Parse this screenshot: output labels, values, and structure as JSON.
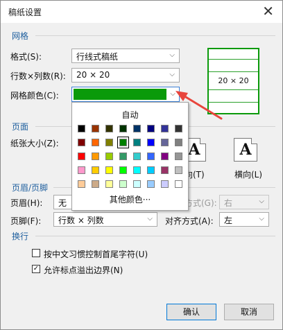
{
  "window": {
    "title": "稿纸设置",
    "close_glyph": "✕"
  },
  "grid_section": {
    "title": "网格",
    "style_label": "格式(S):",
    "style_value": "行线式稿纸",
    "rows_cols_label": "行数×列数(R):",
    "rows_cols_value": "20 × 20",
    "color_label": "网格颜色(C):",
    "color_value_hex": "#0a9a0a"
  },
  "preview": {
    "text": "20 × 20",
    "line_color": "#2aa02a"
  },
  "color_dropdown": {
    "auto_label": "自动",
    "more_label": "其他颜色···",
    "rows": [
      [
        "#000000",
        "#993300",
        "#333300",
        "#003300",
        "#003366",
        "#000080",
        "#333399",
        "#333333"
      ],
      [
        "#800000",
        "#ff6600",
        "#808000",
        "#008000",
        "#008080",
        "#0000ff",
        "#666699",
        "#808080"
      ],
      [
        "#ff0000",
        "#ff9900",
        "#99cc00",
        "#339966",
        "#33cccc",
        "#3366ff",
        "#800080",
        "#969696"
      ],
      [
        "#ff99cc",
        "#ffcc00",
        "#ffff00",
        "#00ff00",
        "#00ffff",
        "#00ccff",
        "#993366",
        "#c0c0c0"
      ],
      [
        "#ffcc99",
        "#ccaa88",
        "#ffff99",
        "#ccffcc",
        "#ccffff",
        "#99ccff",
        "#ccccff",
        "#ffffff"
      ]
    ],
    "selected": {
      "row": 1,
      "col": 3
    }
  },
  "page_section": {
    "title": "页面",
    "size_label": "纸张大小(Z):",
    "orient_glyph": "A",
    "portrait_label": "向(T)",
    "landscape_label": "横向(L)"
  },
  "header_footer_section": {
    "title": "页眉/页脚",
    "header_label": "页眉(H):",
    "header_value": "无",
    "header_align_label": "方式(G):",
    "header_align_value": "右",
    "footer_label": "页脚(F):",
    "footer_value": "行数 × 列数",
    "footer_align_label": "对齐方式(A):",
    "footer_align_value": "左"
  },
  "wrap_section": {
    "title": "换行",
    "option1_label": "按中文习惯控制首尾字符(U)",
    "option1_checked": false,
    "option2_label": "允许标点溢出边界(N)",
    "option2_checked": true,
    "check_glyph": "✓"
  },
  "buttons": {
    "ok": "确认",
    "cancel": "取消"
  },
  "accent_colors": {
    "section_title": "#1f5f9e",
    "annotation_arrow": "#e8453c"
  }
}
